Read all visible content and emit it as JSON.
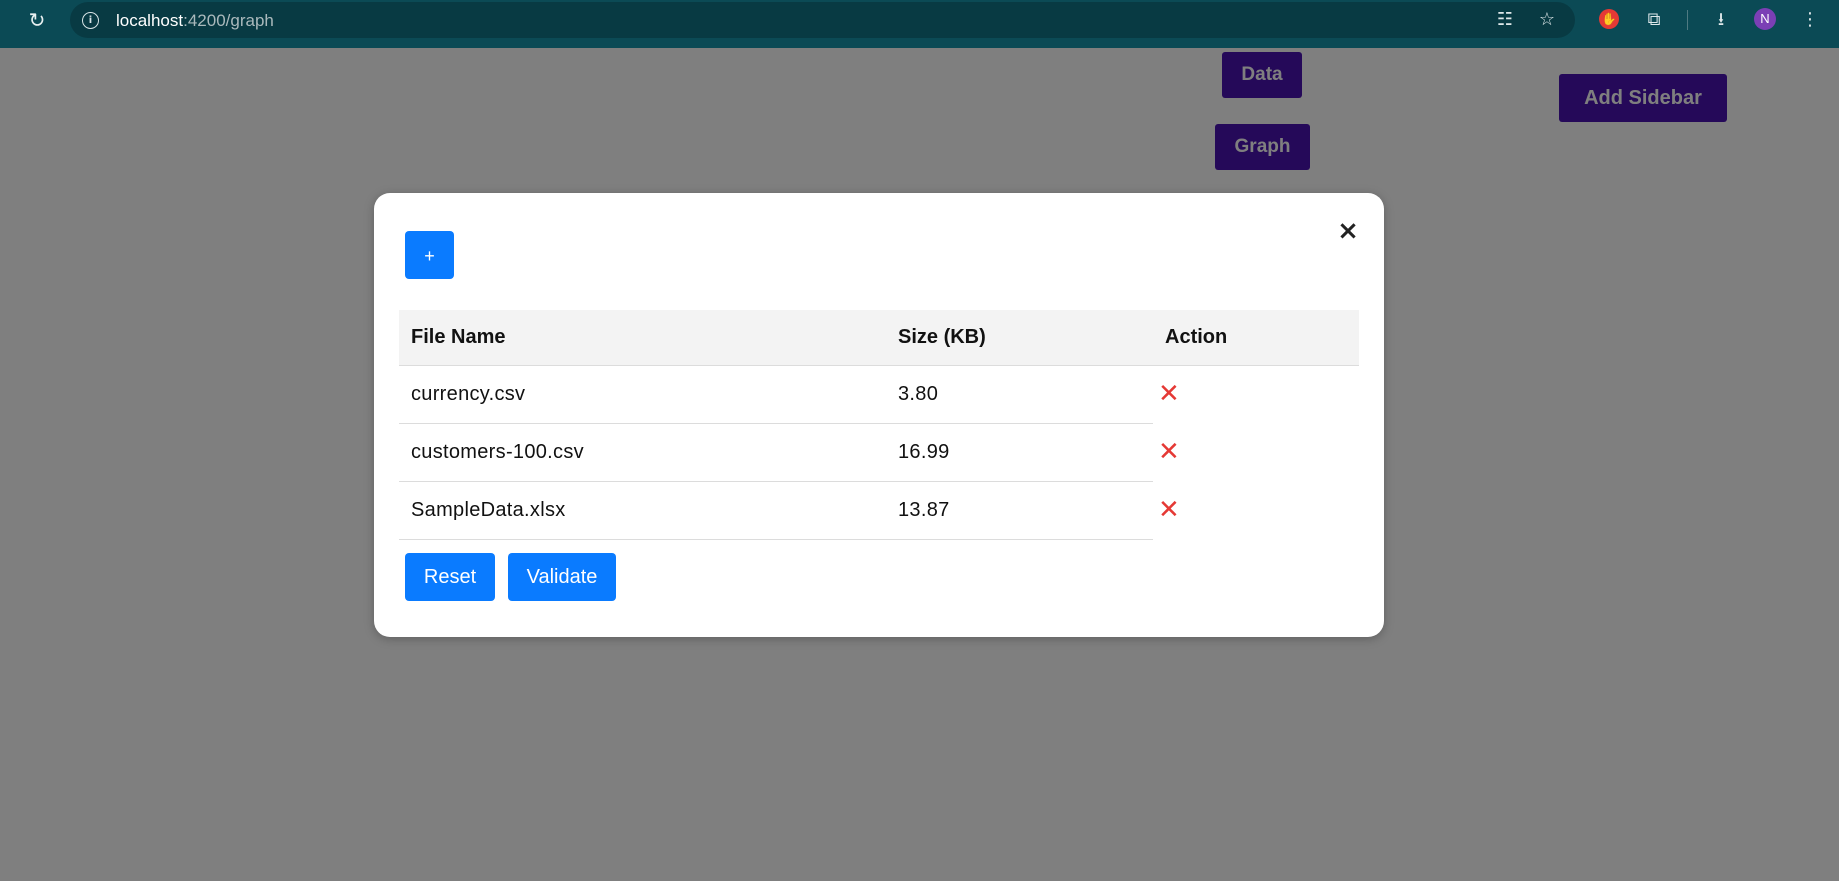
{
  "browser": {
    "url_host": "localhost",
    "url_path": ":4200/graph",
    "profile_initial": "N",
    "icons": [
      "reload-icon",
      "info-icon",
      "translate-icon",
      "star-icon",
      "adblock-icon",
      "extensions-icon",
      "download-icon",
      "avatar",
      "menu-icon"
    ]
  },
  "page": {
    "data_button": "Data",
    "graph_button": "Graph",
    "add_sidebar_button": "Add Sidebar"
  },
  "modal": {
    "close_label": "×",
    "add_label": "+",
    "table": {
      "headers": [
        "File Name",
        "Size (KB)",
        "Action"
      ],
      "rows": [
        {
          "name": "currency.csv",
          "size": "3.80",
          "action_icon": "delete-icon"
        },
        {
          "name": "customers-100.csv",
          "size": "16.99",
          "action_icon": "delete-icon"
        },
        {
          "name": "SampleData.xlsx",
          "size": "13.87",
          "action_icon": "delete-icon"
        }
      ]
    },
    "reset_label": "Reset",
    "validate_label": "Validate"
  },
  "colors": {
    "chrome_bg": "#0b4a55",
    "purple_button": "#4a12b3",
    "blue_button": "#0a7bff",
    "delete_red": "#e53935"
  }
}
